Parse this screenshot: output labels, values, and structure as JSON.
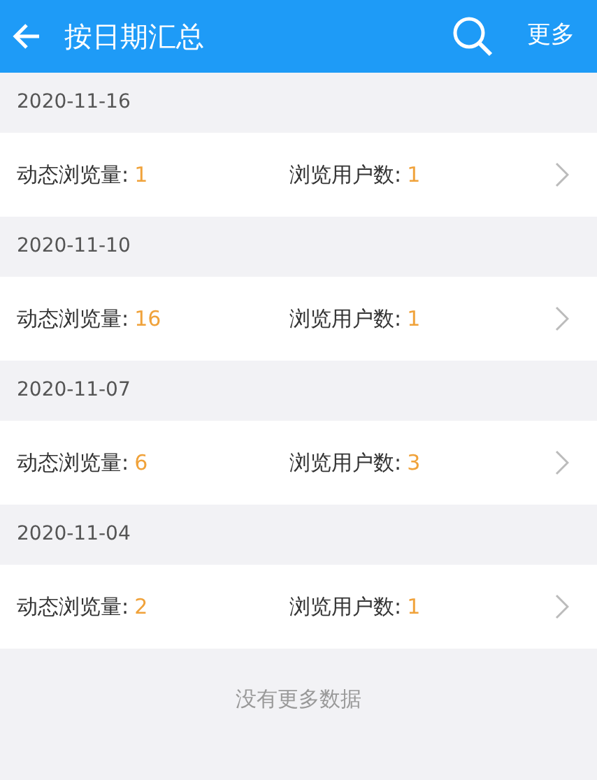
{
  "header": {
    "title": "按日期汇总",
    "more": "更多"
  },
  "days": [
    {
      "date": "2020-11-16",
      "stats": [
        {
          "label": "动态浏览量:",
          "value": "1"
        },
        {
          "label": "浏览用户数:",
          "value": "1"
        }
      ]
    },
    {
      "date": "2020-11-10",
      "stats": [
        {
          "label": "动态浏览量:",
          "value": "16"
        },
        {
          "label": "浏览用户数:",
          "value": "1"
        }
      ]
    },
    {
      "date": "2020-11-07",
      "stats": [
        {
          "label": "动态浏览量:",
          "value": "6"
        },
        {
          "label": "浏览用户数:",
          "value": "3"
        }
      ]
    },
    {
      "date": "2020-11-04",
      "stats": [
        {
          "label": "动态浏览量:",
          "value": "2"
        },
        {
          "label": "浏览用户数:",
          "value": "1"
        }
      ]
    }
  ],
  "footer": "没有更多数据"
}
